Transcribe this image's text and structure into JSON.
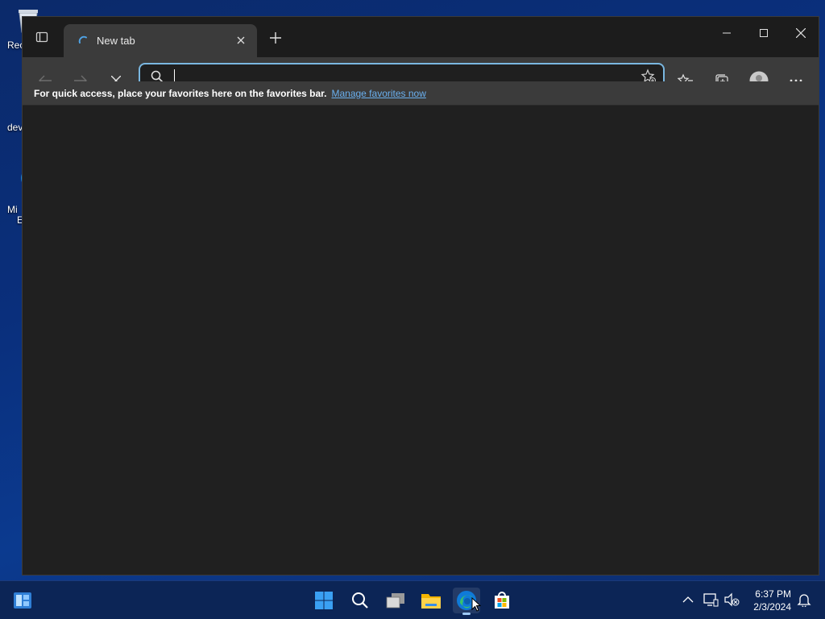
{
  "desktop": {
    "icons": [
      {
        "label": "Rec",
        "icon": "recycle-bin-icon"
      },
      {
        "label": "devi",
        "icon": "file-icon"
      },
      {
        "label": "Mi\nE",
        "icon": "edge-shortcut-icon"
      }
    ]
  },
  "browser": {
    "tab": {
      "title": "New tab",
      "status": "loading"
    },
    "new_tab_label": "+",
    "address": {
      "value": "",
      "placeholder": ""
    },
    "favorites_bar": {
      "message": "For quick access, place your favorites here on the favorites bar.",
      "link": "Manage favorites now"
    }
  },
  "taskbar": {
    "apps": [
      "start-icon",
      "search-icon",
      "task-view-icon",
      "file-explorer-icon",
      "edge-icon",
      "store-icon"
    ],
    "active_app": "edge-icon",
    "clock": {
      "time": "6:37 PM",
      "date": "2/3/2024"
    }
  },
  "colors": {
    "accent": "#7ab7e0",
    "link": "#6ab0ef",
    "taskbar": "#0c2556"
  }
}
